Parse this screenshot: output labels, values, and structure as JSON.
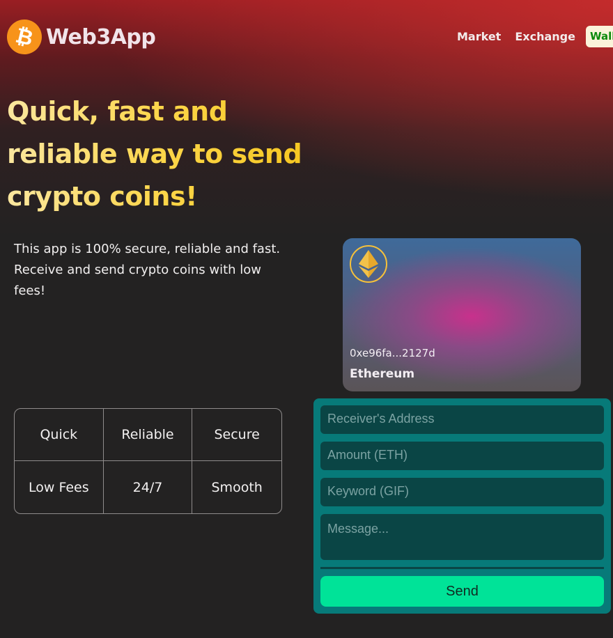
{
  "header": {
    "app_name": "Web3App",
    "logo_icon": "bitcoin-icon",
    "logo_glyph": "₿",
    "nav": {
      "market": "Market",
      "exchange": "Exchange",
      "wallets": "Wallets"
    }
  },
  "hero": {
    "title_line1": "Quick, fast and",
    "title_line2": "reliable way to send",
    "title_line3": "crypto coins!",
    "subtitle": "This app is 100% secure, reliable and fast. Receive and send crypto coins with low fees!"
  },
  "features": {
    "items": [
      "Quick",
      "Reliable",
      "Secure",
      "Low Fees",
      "24/7",
      "Smooth"
    ]
  },
  "card": {
    "icon": "ethereum-icon",
    "address": "0xe96fa...2127d",
    "network": "Ethereum"
  },
  "form": {
    "receiver_placeholder": "Receiver's Address",
    "amount_placeholder": "Amount (ETH)",
    "keyword_placeholder": "Keyword (GIF)",
    "message_placeholder": "Message...",
    "send_label": "Send"
  },
  "colors": {
    "accent_yellow": "#fcd64a",
    "send_green": "#00e398",
    "panel_teal": "#077a79",
    "bitcoin_orange": "#f7931a"
  }
}
